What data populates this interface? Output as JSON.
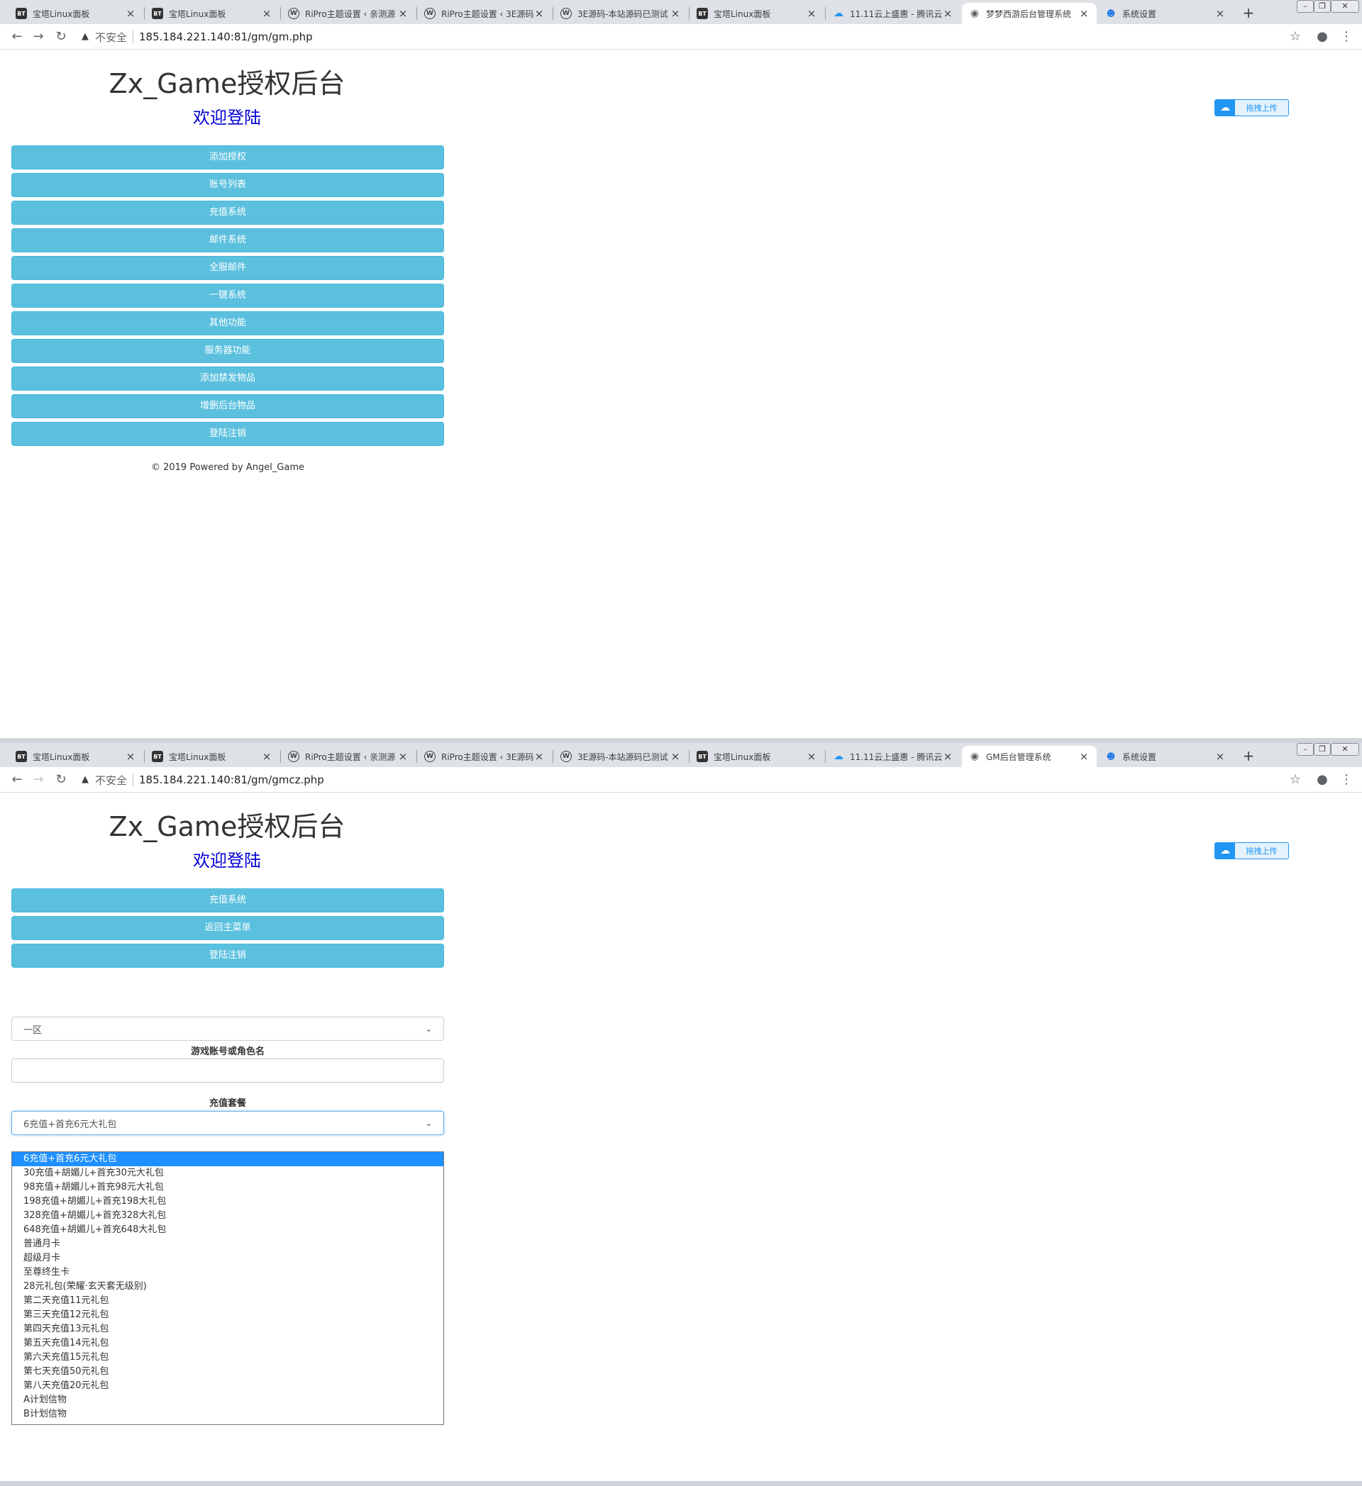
{
  "browser": {
    "tabs": [
      {
        "icon": "BT",
        "label": "宝塔Linux面板"
      },
      {
        "icon": "BT",
        "label": "宝塔Linux面板"
      },
      {
        "icon": "W",
        "label": "RiPro主题设置 ‹ 亲测源"
      },
      {
        "icon": "W",
        "label": "RiPro主题设置 ‹ 3E源码"
      },
      {
        "icon": "W",
        "label": "3E源码-本站源码已测试"
      },
      {
        "icon": "BT",
        "label": "宝塔Linux面板"
      },
      {
        "icon": "☁",
        "label": "11.11云上盛惠 - 腾讯云"
      },
      {
        "icon": "◉",
        "label": "梦梦西游后台管理系统"
      },
      {
        "icon": "☻",
        "label": "系统设置"
      }
    ],
    "tab7_label_window2": "GM后台管理系统",
    "new_tab": "+",
    "insecure_label": "不安全",
    "url_window1": "185.184.221.140:81/gm/gm.php",
    "url_window2": "185.184.221.140:81/gm/gmcz.php",
    "icons": {
      "back": "arrow-left-icon",
      "forward": "arrow-right-icon",
      "reload": "reload-icon",
      "star": "star-icon",
      "profile": "profile-icon",
      "menu": "more-vert-icon"
    }
  },
  "page": {
    "title": "Zx_Game授权后台",
    "welcome": "欢迎登陆",
    "upload_badge": "拖拽上传",
    "footer": "© 2019 Powered by Angel_Game"
  },
  "window1": {
    "menu": [
      "添加授权",
      "账号列表",
      "充值系统",
      "邮件系统",
      "全服邮件",
      "一键系统",
      "其他功能",
      "服务器功能",
      "添加禁发物品",
      "增删后台物品",
      "登陆注销"
    ]
  },
  "window2": {
    "menu": [
      "充值系统",
      "返回主菜单",
      "登陆注销"
    ],
    "server_select": "一区",
    "account_label": "游戏账号或角色名",
    "account_value": "",
    "package_label": "充值套餐",
    "package_selected": "6充值+首充6元大礼包",
    "package_options": [
      "6充值+首充6元大礼包",
      "30充值+胡媚儿+首充30元大礼包",
      "98充值+胡媚儿+首充98元大礼包",
      "198充值+胡媚儿+首充198大礼包",
      "328充值+胡媚儿+首充328大礼包",
      "648充值+胡媚儿+首充648大礼包",
      "普通月卡",
      "超级月卡",
      "至尊终生卡",
      "28元礼包(荣耀·玄天套无级别)",
      "第二天充值11元礼包",
      "第三天充值12元礼包",
      "第四天充值13元礼包",
      "第五天充值14元礼包",
      "第六天充值15元礼包",
      "第七天充值50元礼包",
      "第八天充值20元礼包",
      "A计划信物",
      "B计划信物"
    ]
  },
  "colors": {
    "button_bg": "#5bc0de",
    "welcome_text": "#0000d6",
    "selected_option": "#1e90ff"
  }
}
